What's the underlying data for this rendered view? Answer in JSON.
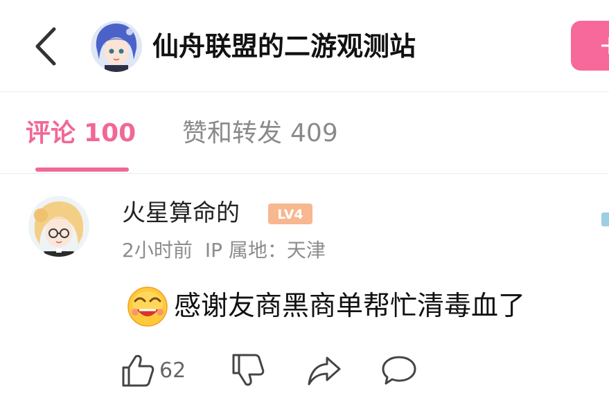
{
  "header": {
    "title": "仙舟联盟的二游观测站",
    "follow_label": "+",
    "back_icon": "chevron-left-icon",
    "avatar_icon": "anime-avatar"
  },
  "tabs": [
    {
      "label": "评论",
      "count": "100",
      "active": true
    },
    {
      "label": "赞和转发",
      "count": "409",
      "active": false
    }
  ],
  "comment": {
    "username": "火星算命的",
    "level": "LV4",
    "time": "2小时前",
    "ip_location": "IP 属地：天津",
    "emoji_icon": "grin-emoji-icon",
    "text": "感谢友商黑商单帮忙清毒血了",
    "likes": "62"
  },
  "colors": {
    "accent_pink": "#f06896",
    "follow_button": "#f7689b",
    "level_badge": "#f7b78f",
    "muted_text": "#8c8c8c"
  }
}
